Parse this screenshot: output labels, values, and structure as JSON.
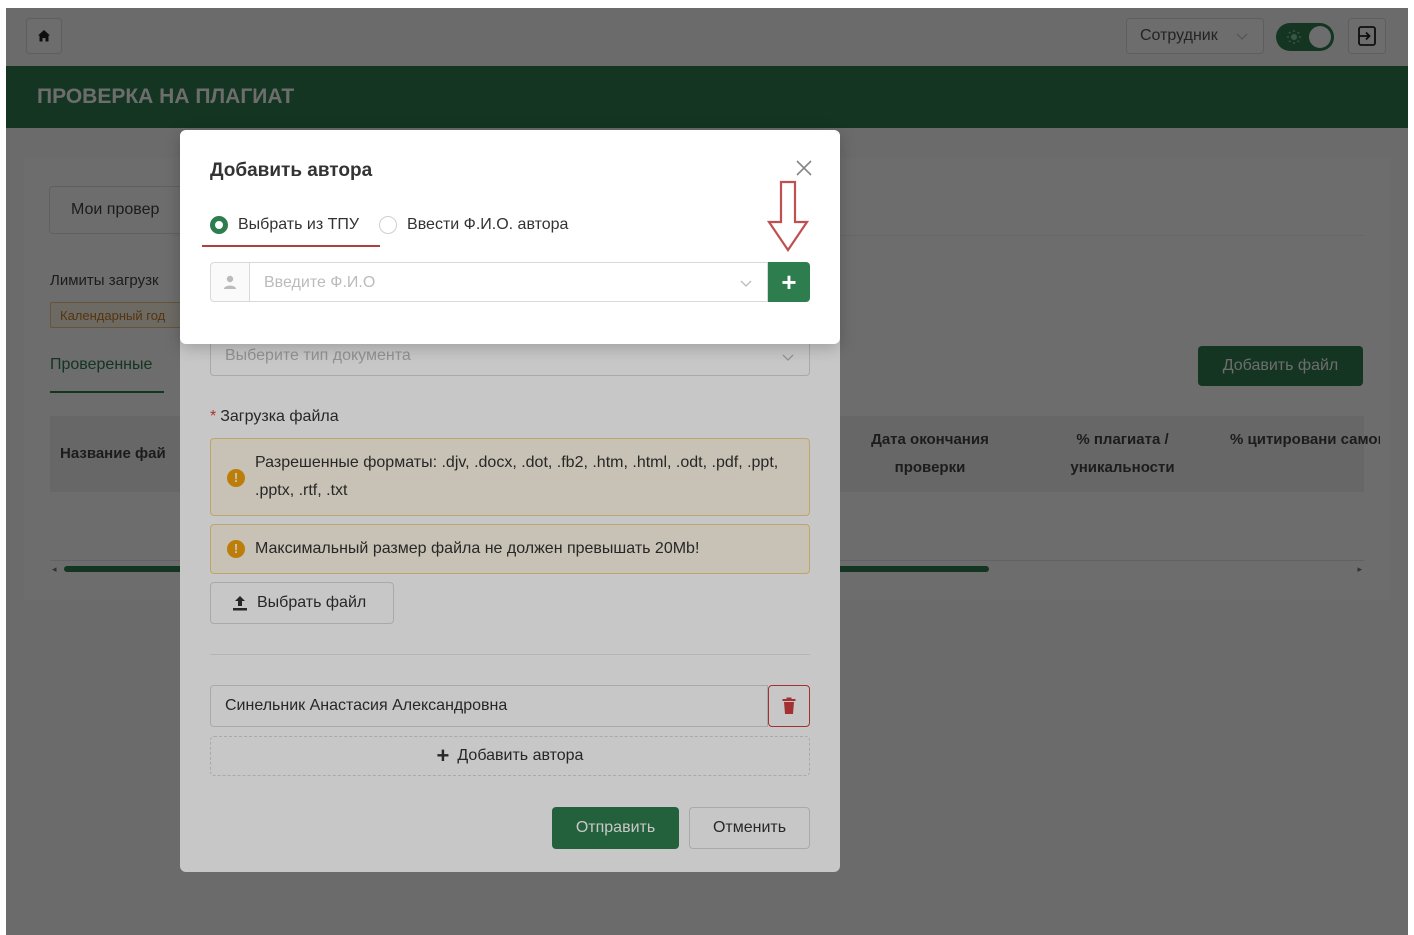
{
  "topbar": {
    "role": "Сотрудник",
    "icons": [
      "home-icon",
      "chevron-down-icon",
      "sun-icon",
      "logout-icon"
    ]
  },
  "page": {
    "title": "ПРОВЕРКА НА ПЛАГИАТ"
  },
  "background": {
    "my_checks_tab": "Мои провер",
    "limits_label": "Лимиты загрузк",
    "limits_tag": "Календарный год",
    "checked_tab": "Проверенные",
    "add_file_button": "Добавить файл",
    "table_headers": [
      "Название фай",
      "Дата окончания проверки",
      "% плагиата / уникальности",
      "% цитировани самоцитирован"
    ]
  },
  "form_modal": {
    "doc_type_placeholder": "Выберите тип документа",
    "upload_label": "Загрузка файла",
    "required_mark": "*",
    "alert_formats": "Разрешенные форматы: .djv, .docx, .dot, .fb2, .htm, .html, .odt, .pdf, .ppt, .pptx, .rtf, .txt",
    "alert_size": "Максимальный размер файла не должен превышать 20Mb!",
    "choose_file_button": "Выбрать файл",
    "author_value": "Синельник Анастасия Александровна",
    "add_author_button": "Добавить автора",
    "submit_button": "Отправить",
    "cancel_button": "Отменить"
  },
  "author_modal": {
    "title": "Добавить автора",
    "radio_tpu": "Выбрать из ТПУ",
    "radio_manual": "Ввести Ф.И.О. автора",
    "selected_radio": "radio_tpu",
    "fio_placeholder": "Введите Ф.И.О",
    "add_button": "+"
  },
  "colors": {
    "primary": "#2e7d4f",
    "warning": "#f3a20c",
    "danger": "#d04040",
    "annotation": "#c05050"
  }
}
